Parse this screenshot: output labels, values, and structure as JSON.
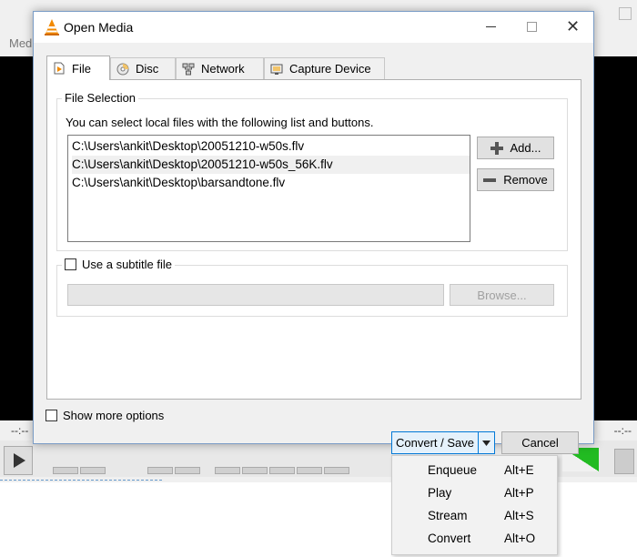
{
  "background_window": {
    "menu_fragment": "Med",
    "time_left": "--:--",
    "time_right": "--:--"
  },
  "dialog": {
    "title": "Open Media",
    "close_glyph": "✕",
    "tabs": [
      {
        "label": "File",
        "icon": "file-icon"
      },
      {
        "label": "Disc",
        "icon": "disc-icon"
      },
      {
        "label": "Network",
        "icon": "network-icon"
      },
      {
        "label": "Capture Device",
        "icon": "capture-device-icon"
      }
    ],
    "file_selection": {
      "title": "File Selection",
      "description": "You can select local files with the following list and buttons.",
      "files": [
        "C:\\Users\\ankit\\Desktop\\20051210-w50s.flv",
        "C:\\Users\\ankit\\Desktop\\20051210-w50s_56K.flv",
        "C:\\Users\\ankit\\Desktop\\barsandtone.flv"
      ],
      "add_label": "Add...",
      "remove_label": "Remove"
    },
    "subtitle": {
      "checkbox_label": "Use a subtitle file",
      "input_value": "",
      "browse_label": "Browse..."
    },
    "show_more_options": "Show more options",
    "convert_save_label": "Convert / Save",
    "cancel_label": "Cancel"
  },
  "dropdown_menu": {
    "items": [
      {
        "label": "Enqueue",
        "shortcut": "Alt+E"
      },
      {
        "label": "Play",
        "shortcut": "Alt+P"
      },
      {
        "label": "Stream",
        "shortcut": "Alt+S"
      },
      {
        "label": "Convert",
        "shortcut": "Alt+O"
      }
    ]
  },
  "colors": {
    "vlc_orange": "#f28a00",
    "volume_green": "#22bb22",
    "dialog_border": "#7a9cc6"
  }
}
